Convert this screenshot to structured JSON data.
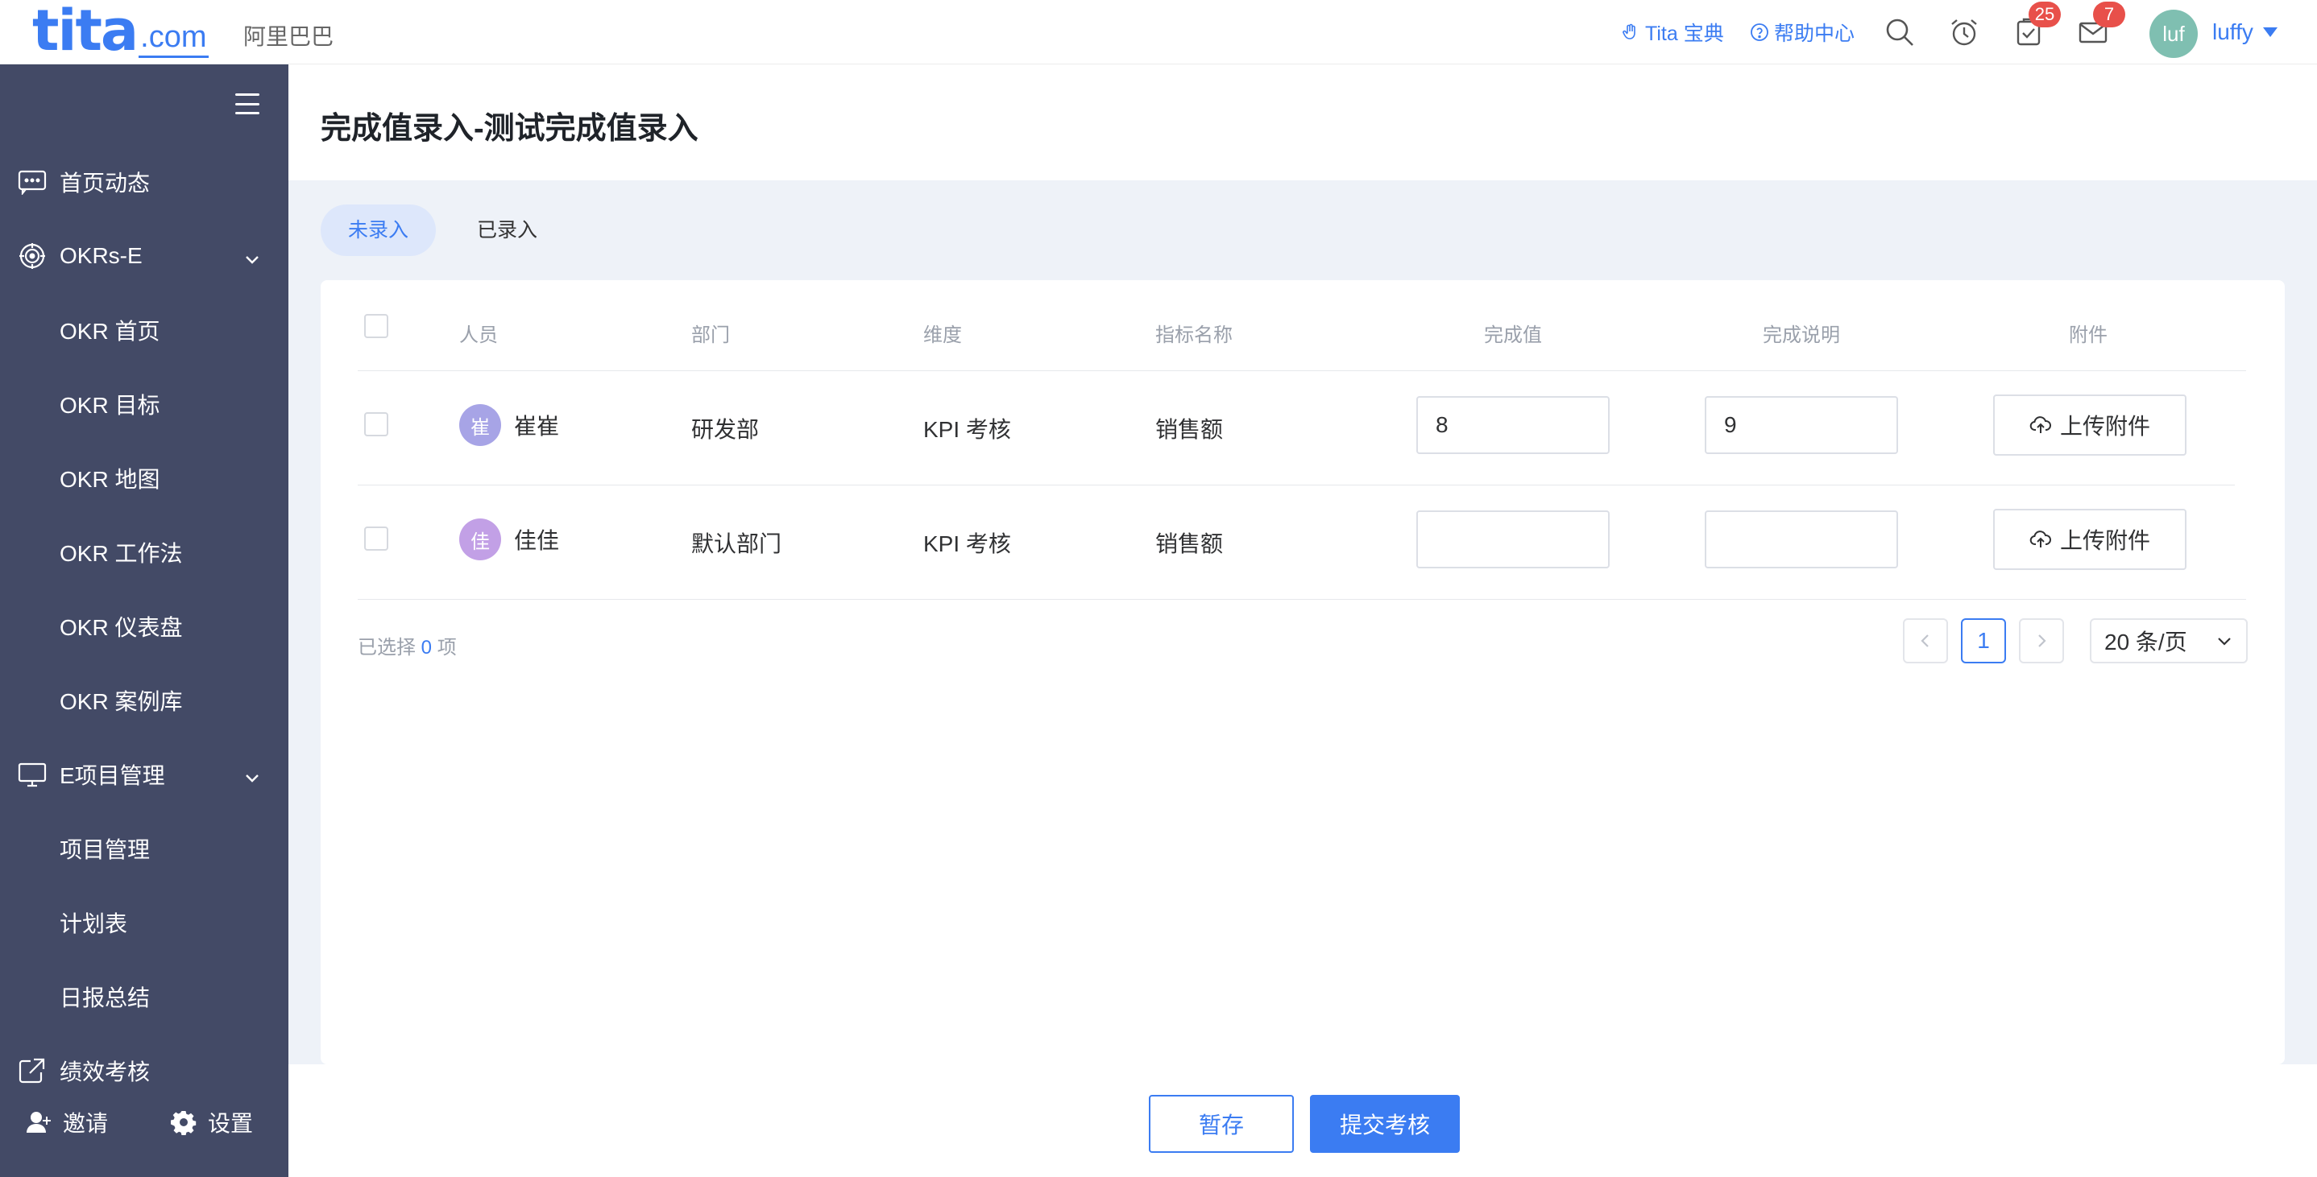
{
  "topbar": {
    "logo_main": "tita",
    "logo_suffix": ".com",
    "company": "阿里巴巴",
    "links": [
      {
        "label": "Tita 宝典",
        "icon": "hand-icon"
      },
      {
        "label": "帮助中心",
        "icon": "help-circle-icon"
      }
    ],
    "icons": [
      "search-icon",
      "alarm-clock-icon",
      "task-icon",
      "mail-icon"
    ],
    "task_badge": "25",
    "mail_badge": "7",
    "avatar_text": "luf",
    "username": "luffy"
  },
  "sidebar": {
    "items": [
      {
        "label": "首页动态",
        "icon": "message-icon"
      },
      {
        "label": "OKRs-E",
        "icon": "target-icon",
        "expanded": true
      },
      {
        "label": "OKR 首页"
      },
      {
        "label": "OKR 目标"
      },
      {
        "label": "OKR 地图"
      },
      {
        "label": "OKR 工作法"
      },
      {
        "label": "OKR 仪表盘"
      },
      {
        "label": "OKR 案例库"
      },
      {
        "label": "E项目管理",
        "icon": "monitor-icon",
        "expanded": true
      },
      {
        "label": "项目管理"
      },
      {
        "label": "计划表"
      },
      {
        "label": "日报总结"
      },
      {
        "label": "绩效考核",
        "icon": "external-link-icon"
      }
    ],
    "invite_label": "邀请",
    "settings_label": "设置"
  },
  "page": {
    "title": "完成值录入-测试完成值录入",
    "tabs": [
      {
        "label": "未录入",
        "active": true
      },
      {
        "label": "已录入",
        "active": false
      }
    ]
  },
  "table": {
    "headers": [
      "人员",
      "部门",
      "维度",
      "指标名称",
      "完成值",
      "完成说明",
      "附件"
    ],
    "rows": [
      {
        "avatar": "崔",
        "avatar_color": "#a7a4e6",
        "name": "崔崔",
        "dept": "研发部",
        "dimension": "KPI 考核",
        "metric": "销售额",
        "value": "8",
        "note": "9",
        "upload": "上传附件"
      },
      {
        "avatar": "佳",
        "avatar_color": "#c2a0e6",
        "name": "佳佳",
        "dept": "默认部门",
        "dimension": "KPI 考核",
        "metric": "销售额",
        "value": "",
        "note": "",
        "upload": "上传附件"
      }
    ]
  },
  "pagination": {
    "selected_prefix": "已选择",
    "selected_count": "0",
    "selected_suffix": "项",
    "current_page": "1",
    "page_size": "20 条/页"
  },
  "footer": {
    "save_label": "暂存",
    "submit_label": "提交考核"
  },
  "colors": {
    "accent": "#3b7cf2",
    "sidebar_bg": "#434a66",
    "badge": "#e8504a"
  }
}
